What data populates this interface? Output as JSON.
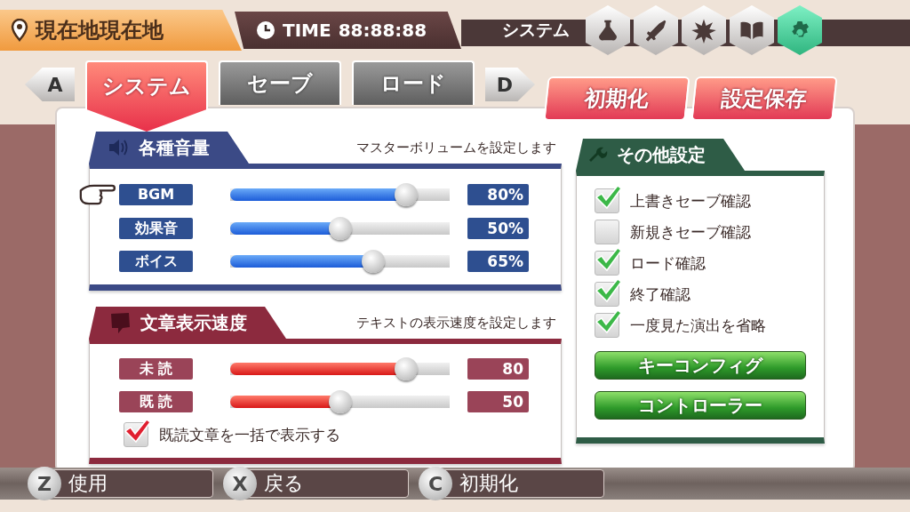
{
  "location": "現在地現在地",
  "time": {
    "label": "TIME",
    "value": "88:88:88"
  },
  "menu": {
    "title": "システム",
    "icons": [
      {
        "kind": "flask",
        "selected": false
      },
      {
        "kind": "sword",
        "selected": false
      },
      {
        "kind": "burst",
        "selected": false
      },
      {
        "kind": "book",
        "selected": false
      },
      {
        "kind": "gear",
        "selected": true
      }
    ]
  },
  "nav": {
    "prev_key": "A",
    "next_key": "D"
  },
  "tabs": [
    {
      "label": "システム",
      "selected": true
    },
    {
      "label": "セーブ",
      "selected": false
    },
    {
      "label": "ロード",
      "selected": false
    }
  ],
  "actions": [
    "初期化",
    "設定保存"
  ],
  "volume": {
    "title": "各種音量",
    "description": "マスターボリュームを設定します",
    "rows": [
      {
        "label": "BGM",
        "level": 0.8,
        "reading": "80%",
        "focused": true
      },
      {
        "label": "効果音",
        "level": 0.5,
        "reading": "50%",
        "focused": false
      },
      {
        "label": "ボイス",
        "level": 0.65,
        "reading": "65%",
        "focused": false
      }
    ]
  },
  "text_speed": {
    "title": "文章表示速度",
    "description": "テキストの表示速度を設定します",
    "rows": [
      {
        "label": "未 読",
        "level": 0.8,
        "reading": "80",
        "focused": false
      },
      {
        "label": "既 読",
        "level": 0.5,
        "reading": "50",
        "focused": false
      }
    ],
    "option": {
      "label": "既読文章を一括で表示する",
      "checked": true
    }
  },
  "other": {
    "title": "その他設定",
    "options": [
      {
        "label": "上書きセーブ確認",
        "checked": true
      },
      {
        "label": "新規きセーブ確認",
        "checked": false
      },
      {
        "label": "ロード確認",
        "checked": true
      },
      {
        "label": "終了確認",
        "checked": true
      },
      {
        "label": "一度見た演出を省略",
        "checked": true
      }
    ],
    "buttons": [
      "キーコンフィグ",
      "コントローラー"
    ]
  },
  "hints": [
    {
      "key": "Z",
      "label": "使用"
    },
    {
      "key": "X",
      "label": "戻る"
    },
    {
      "key": "C",
      "label": "初期化"
    }
  ]
}
